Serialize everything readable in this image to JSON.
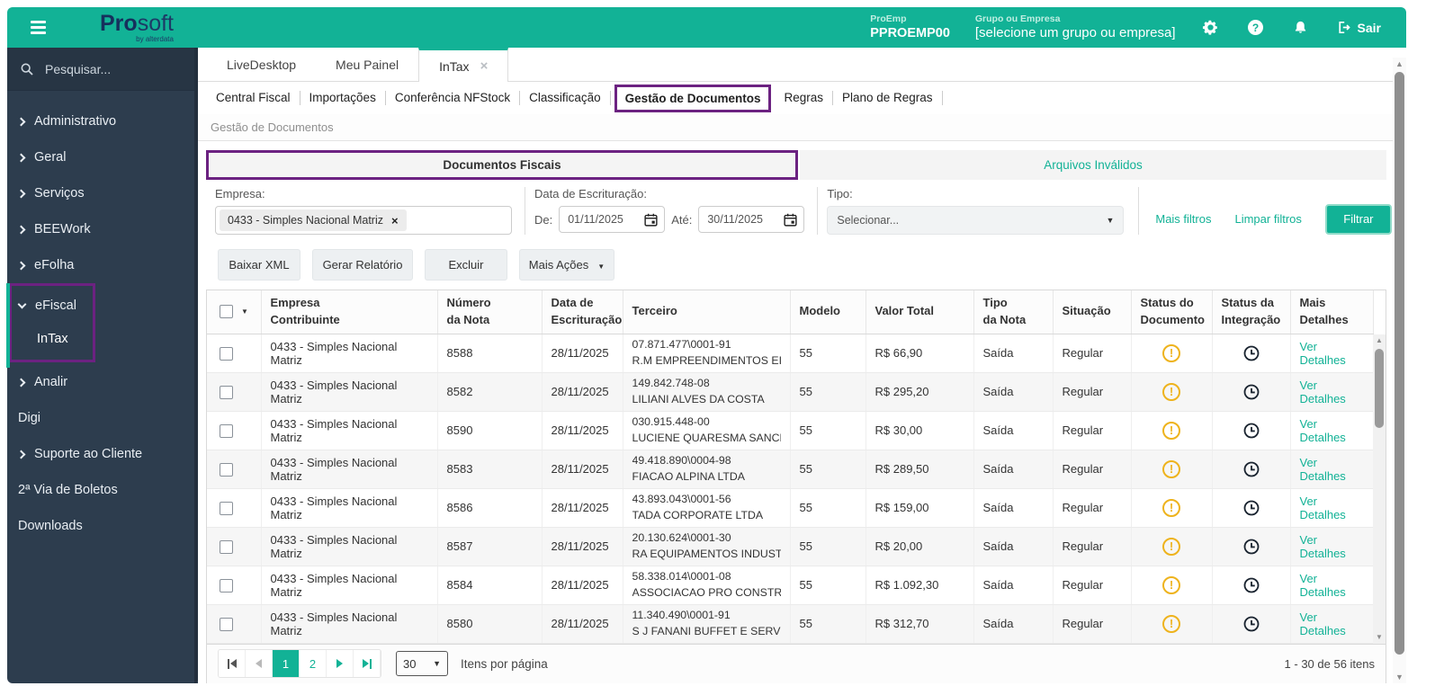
{
  "colors": {
    "accent": "#12b296",
    "annotation_purple": "#6c2281",
    "warning_yellow": "#eeb31d",
    "sidebar_bg": "#2d3d4e"
  },
  "header": {
    "logo_bold": "Pro",
    "logo_light": "soft",
    "logo_byline": "by alterdata",
    "proemp_label": "ProEmp",
    "proemp_value": "PPROEMP00",
    "grupo_label": "Grupo ou Empresa",
    "grupo_value": "[selecione um grupo ou empresa]",
    "sair_label": "Sair"
  },
  "sidebar": {
    "search_placeholder": "Pesquisar...",
    "items": [
      "Administrativo",
      "Geral",
      "Serviços",
      "BEEWork",
      "eFolha",
      "eFiscal",
      "InTax",
      "Analir",
      "Digi",
      "Suporte ao Cliente",
      "2ª Via de Boletos",
      "Downloads"
    ]
  },
  "tabs": {
    "items": [
      "LiveDesktop",
      "Meu Painel",
      "InTax"
    ],
    "close_symbol": "×"
  },
  "subtabs": [
    "Central Fiscal",
    "Importações",
    "Conferência NFStock",
    "Classificação",
    "Gestão de Documentos",
    "Regras",
    "Plano de Regras"
  ],
  "breadcrumb": "Gestão de Documentos",
  "panel_tabs": {
    "documentos": "Documentos Fiscais",
    "arquivos": "Arquivos Inválidos"
  },
  "filters": {
    "empresa_label": "Empresa:",
    "empresa_chip": "0433 - Simples Nacional Matriz",
    "chip_close": "×",
    "data_label": "Data de Escrituração:",
    "de_label": "De:",
    "de_value": "01/11/2025",
    "ate_label": "Até:",
    "ate_value": "30/11/2025",
    "tipo_label": "Tipo:",
    "tipo_value": "Selecionar...",
    "mais_filtros": "Mais filtros",
    "limpar_filtros": "Limpar filtros",
    "filtrar": "Filtrar",
    "caret": "▼"
  },
  "actions": {
    "baixar": "Baixar XML",
    "gerar": "Gerar Relatório",
    "excluir": "Excluir",
    "mais": "Mais Ações",
    "caret": "▼"
  },
  "table": {
    "columns": [
      [
        "Empresa",
        "Contribuinte"
      ],
      [
        "Número",
        "da Nota"
      ],
      [
        "Data de",
        "Escrituração"
      ],
      [
        "Terceiro"
      ],
      [
        "Modelo"
      ],
      [
        "Valor Total"
      ],
      [
        "Tipo",
        "da Nota"
      ],
      [
        "Situação"
      ],
      [
        "Status do",
        "Documento"
      ],
      [
        "Status da",
        "Integração"
      ],
      [
        "Mais Detalhes"
      ]
    ],
    "rows": [
      {
        "empresa": "0433 - Simples Nacional Matriz",
        "numero": "8588",
        "data": "28/11/2025",
        "terceiro_doc": "07.871.477\\0001-91",
        "terceiro_nome": "R.M EMPREENDIMENTOS EIRELI",
        "modelo": "55",
        "valor": "R$ 66,90",
        "tipo": "Saída",
        "situacao": "Regular",
        "detalhes": "Ver Detalhes"
      },
      {
        "empresa": "0433 - Simples Nacional Matriz",
        "numero": "8582",
        "data": "28/11/2025",
        "terceiro_doc": "149.842.748-08",
        "terceiro_nome": "LILIANI ALVES DA COSTA",
        "modelo": "55",
        "valor": "R$ 295,20",
        "tipo": "Saída",
        "situacao": "Regular",
        "detalhes": "Ver Detalhes"
      },
      {
        "empresa": "0433 - Simples Nacional Matriz",
        "numero": "8590",
        "data": "28/11/2025",
        "terceiro_doc": "030.915.448-00",
        "terceiro_nome": "LUCIENE QUARESMA SANCHES M...",
        "modelo": "55",
        "valor": "R$ 30,00",
        "tipo": "Saída",
        "situacao": "Regular",
        "detalhes": "Ver Detalhes"
      },
      {
        "empresa": "0433 - Simples Nacional Matriz",
        "numero": "8583",
        "data": "28/11/2025",
        "terceiro_doc": "49.418.890\\0004-98",
        "terceiro_nome": "FIACAO ALPINA LTDA",
        "modelo": "55",
        "valor": "R$ 289,50",
        "tipo": "Saída",
        "situacao": "Regular",
        "detalhes": "Ver Detalhes"
      },
      {
        "empresa": "0433 - Simples Nacional Matriz",
        "numero": "8586",
        "data": "28/11/2025",
        "terceiro_doc": "43.893.043\\0001-56",
        "terceiro_nome": "TADA CORPORATE LTDA",
        "modelo": "55",
        "valor": "R$ 159,00",
        "tipo": "Saída",
        "situacao": "Regular",
        "detalhes": "Ver Detalhes"
      },
      {
        "empresa": "0433 - Simples Nacional Matriz",
        "numero": "8587",
        "data": "28/11/2025",
        "terceiro_doc": "20.130.624\\0001-30",
        "terceiro_nome": "RA EQUIPAMENTOS INDUSTRIAIS...",
        "modelo": "55",
        "valor": "R$ 20,00",
        "tipo": "Saída",
        "situacao": "Regular",
        "detalhes": "Ver Detalhes"
      },
      {
        "empresa": "0433 - Simples Nacional Matriz",
        "numero": "8584",
        "data": "28/11/2025",
        "terceiro_doc": "58.338.014\\0001-08",
        "terceiro_nome": "ASSOCIACAO PRO CONSTRUCAO...",
        "modelo": "55",
        "valor": "R$ 1.092,30",
        "tipo": "Saída",
        "situacao": "Regular",
        "detalhes": "Ver Detalhes"
      },
      {
        "empresa": "0433 - Simples Nacional Matriz",
        "numero": "8580",
        "data": "28/11/2025",
        "terceiro_doc": "11.340.490\\0001-91",
        "terceiro_nome": "S J FANANI BUFFET E SERVICOS L...",
        "modelo": "55",
        "valor": "R$ 312,70",
        "tipo": "Saída",
        "situacao": "Regular",
        "detalhes": "Ver Detalhes"
      }
    ]
  },
  "pagination": {
    "pages": [
      "1",
      "2"
    ],
    "page_size": "30",
    "items_per_page_label": "Itens por página",
    "range_label": "1 - 30 de 56 itens"
  }
}
